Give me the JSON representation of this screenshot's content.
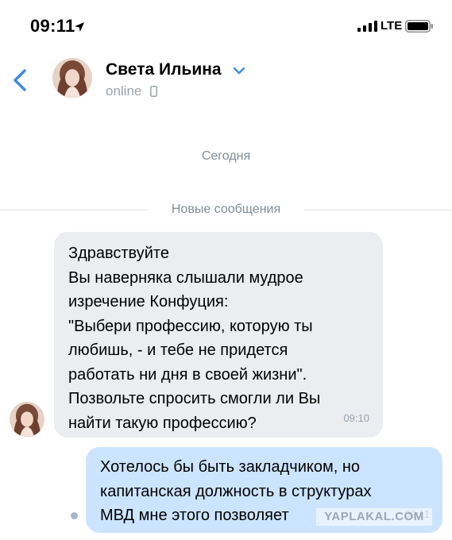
{
  "status_bar": {
    "time": "09:11",
    "network": "LTE",
    "icons": [
      "location-arrow-icon",
      "signal-icon",
      "battery-icon"
    ]
  },
  "header": {
    "contact_name": "Света Ильина",
    "status": "online",
    "icons": [
      "back-chevron-icon",
      "chevron-down-icon",
      "mobile-phone-icon"
    ]
  },
  "chat": {
    "date_label": "Сегодня",
    "new_messages_label": "Новые сообщения",
    "messages": [
      {
        "direction": "incoming",
        "lines": [
          "Здравствуйте",
          "Вы наверняка слышали мудрое",
          "изречение Конфуция:",
          "\"Выбери профессию, которую ты",
          "любишь, - и тебе не придется",
          "работать ни дня в своей жизни\".",
          "Позвольте спросить смогли ли Вы",
          "найти такую профессию?"
        ],
        "time": "09:10"
      },
      {
        "direction": "outgoing",
        "lines": [
          "Хотелось бы быть закладчиком,  но",
          "капитанская должность в структурах",
          "МВД мне этого позволяет"
        ],
        "time": "09:11"
      }
    ]
  },
  "watermark": "YAPLAKAL.COM",
  "colors": {
    "incoming_bubble": "#ebedf0",
    "outgoing_bubble": "#cce4ff",
    "accent": "#3f8ae0",
    "secondary_text": "#818c99"
  }
}
